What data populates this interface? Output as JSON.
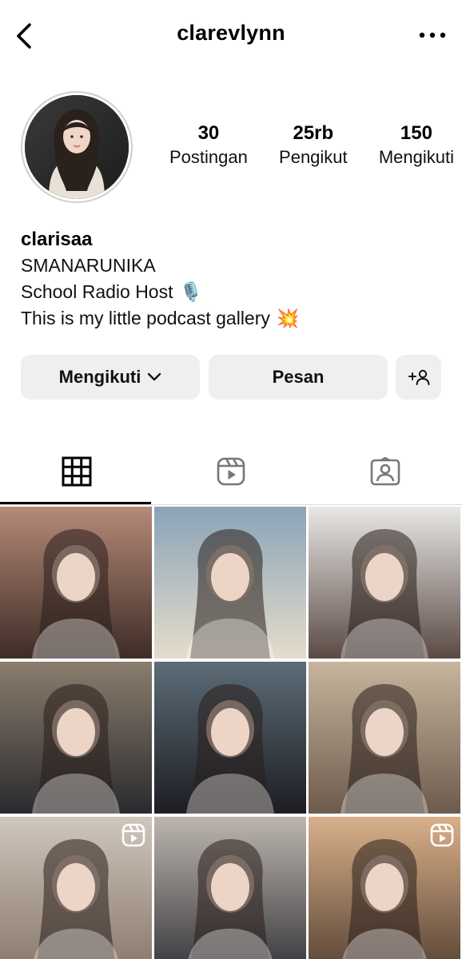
{
  "header": {
    "username": "clarevlynn",
    "back_icon": "chevron-left-icon",
    "more_icon": "more-horizontal-icon"
  },
  "profile": {
    "stats": [
      {
        "value": "30",
        "label": "Postingan"
      },
      {
        "value": "25rb",
        "label": "Pengikut"
      },
      {
        "value": "150",
        "label": "Mengikuti"
      }
    ],
    "display_name": "clarisaa",
    "bio_lines": [
      {
        "text": "SMANARUNIKA",
        "emoji": ""
      },
      {
        "text": "School Radio Host",
        "emoji": "🎙️"
      },
      {
        "text": "This is my little podcast gallery",
        "emoji": "💥"
      }
    ]
  },
  "actions": {
    "following_label": "Mengikuti",
    "message_label": "Pesan",
    "add_person_icon": "add-person-icon"
  },
  "tabs": [
    {
      "name": "grid-icon",
      "active": true
    },
    {
      "name": "reels-icon",
      "active": false
    },
    {
      "name": "tagged-icon",
      "active": false
    }
  ],
  "grid": {
    "posts": [
      {
        "kind": "photo",
        "colors": [
          "#b58a78",
          "#3e2c27"
        ]
      },
      {
        "kind": "photo",
        "colors": [
          "#8aa3b8",
          "#e6dccb"
        ]
      },
      {
        "kind": "photo",
        "colors": [
          "#e9e8e6",
          "#5a4a44"
        ]
      },
      {
        "kind": "photo",
        "colors": [
          "#8b7d6c",
          "#2a2a2e"
        ]
      },
      {
        "kind": "photo",
        "colors": [
          "#5c6c78",
          "#1d1d22"
        ]
      },
      {
        "kind": "photo",
        "colors": [
          "#c8b59e",
          "#6d5a4c"
        ]
      },
      {
        "kind": "reel",
        "colors": [
          "#cfc6bc",
          "#8a7a6c"
        ]
      },
      {
        "kind": "photo",
        "colors": [
          "#bcb6ae",
          "#3c3a3f"
        ]
      },
      {
        "kind": "reel",
        "colors": [
          "#d9b08a",
          "#5b4636"
        ]
      }
    ]
  }
}
